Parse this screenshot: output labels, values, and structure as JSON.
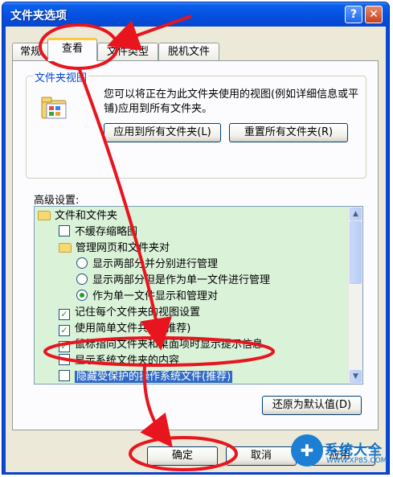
{
  "window": {
    "title": "文件夹选项",
    "help_label": "?",
    "close_label": "✕"
  },
  "tabs": [
    {
      "label": "常规"
    },
    {
      "label": "查看"
    },
    {
      "label": "文件类型"
    },
    {
      "label": "脱机文件"
    }
  ],
  "folder_views": {
    "legend": "文件夹视图",
    "description": "您可以将正在为此文件夹使用的视图(例如详细信息或平铺)应用到所有文件夹。",
    "apply_label": "应用到所有文件夹(L)",
    "reset_label": "重置所有文件夹(R)"
  },
  "advanced": {
    "label": "高级设置:",
    "items": [
      {
        "type": "folder",
        "label": "文件和文件夹"
      },
      {
        "type": "checkbox",
        "label": "不缓存缩略图",
        "checked": false
      },
      {
        "type": "folder",
        "label": "管理网页和文件夹对"
      },
      {
        "type": "radio",
        "label": "显示两部分并分别进行管理",
        "checked": false
      },
      {
        "type": "radio",
        "label": "显示两部分但是作为单一文件进行管理",
        "checked": false
      },
      {
        "type": "radio",
        "label": "作为单一文件显示和管理对",
        "checked": true
      },
      {
        "type": "checkbox",
        "label": "记住每个文件夹的视图设置",
        "checked": true
      },
      {
        "type": "checkbox",
        "label": "使用简单文件共享 (推荐)",
        "checked": true
      },
      {
        "type": "checkbox",
        "label": "鼠标指向文件夹和桌面项时显示提示信息",
        "checked": true
      },
      {
        "type": "checkbox",
        "label": "显示系统文件夹的内容",
        "checked": false
      },
      {
        "type": "checkbox",
        "label": "隐藏受保护的操作系统文件(推荐)",
        "checked": false
      }
    ],
    "restore_label": "还原为默认值(D)"
  },
  "footer": {
    "ok_label": "确定",
    "cancel_label": "取消",
    "apply_label": "应用"
  },
  "watermark": {
    "logo_glyph": "✚",
    "text": "系统大全",
    "url": "WWW.XP85.COM"
  },
  "colors": {
    "titlebar": "#0550e0",
    "list_background": "#d9f2d8",
    "selection": "#316ac5",
    "annotation": "#e8141e"
  }
}
